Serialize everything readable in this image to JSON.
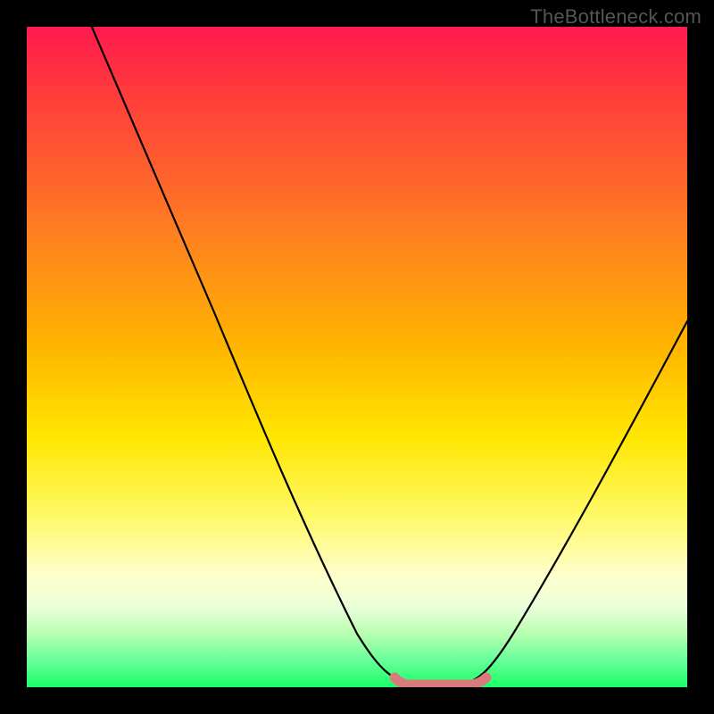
{
  "watermark": "TheBottleneck.com",
  "chart_data": {
    "type": "line",
    "title": "",
    "xlabel": "",
    "ylabel": "",
    "xlim": [
      0,
      1
    ],
    "ylim": [
      0,
      1
    ],
    "series": [
      {
        "name": "bottleneck-curve",
        "x": [
          0.0,
          0.05,
          0.1,
          0.15,
          0.2,
          0.25,
          0.3,
          0.35,
          0.4,
          0.45,
          0.5,
          0.53,
          0.56,
          0.6,
          0.64,
          0.68,
          0.72,
          0.78,
          0.85,
          0.92,
          1.0
        ],
        "y": [
          1.15,
          1.02,
          0.9,
          0.78,
          0.66,
          0.55,
          0.44,
          0.33,
          0.22,
          0.12,
          0.04,
          0.015,
          0.005,
          0.0,
          0.0,
          0.005,
          0.03,
          0.1,
          0.22,
          0.37,
          0.55
        ]
      }
    ],
    "highlight": {
      "name": "optimal-zone",
      "x_range": [
        0.555,
        0.695
      ],
      "y": 0.0,
      "color": "#d97b7b"
    },
    "gradient_colors": {
      "top": "#ff1a4d",
      "upper_mid": "#ff8c1a",
      "mid": "#ffe600",
      "lower_mid": "#ffffcc",
      "bottom": "#1aff66"
    }
  }
}
